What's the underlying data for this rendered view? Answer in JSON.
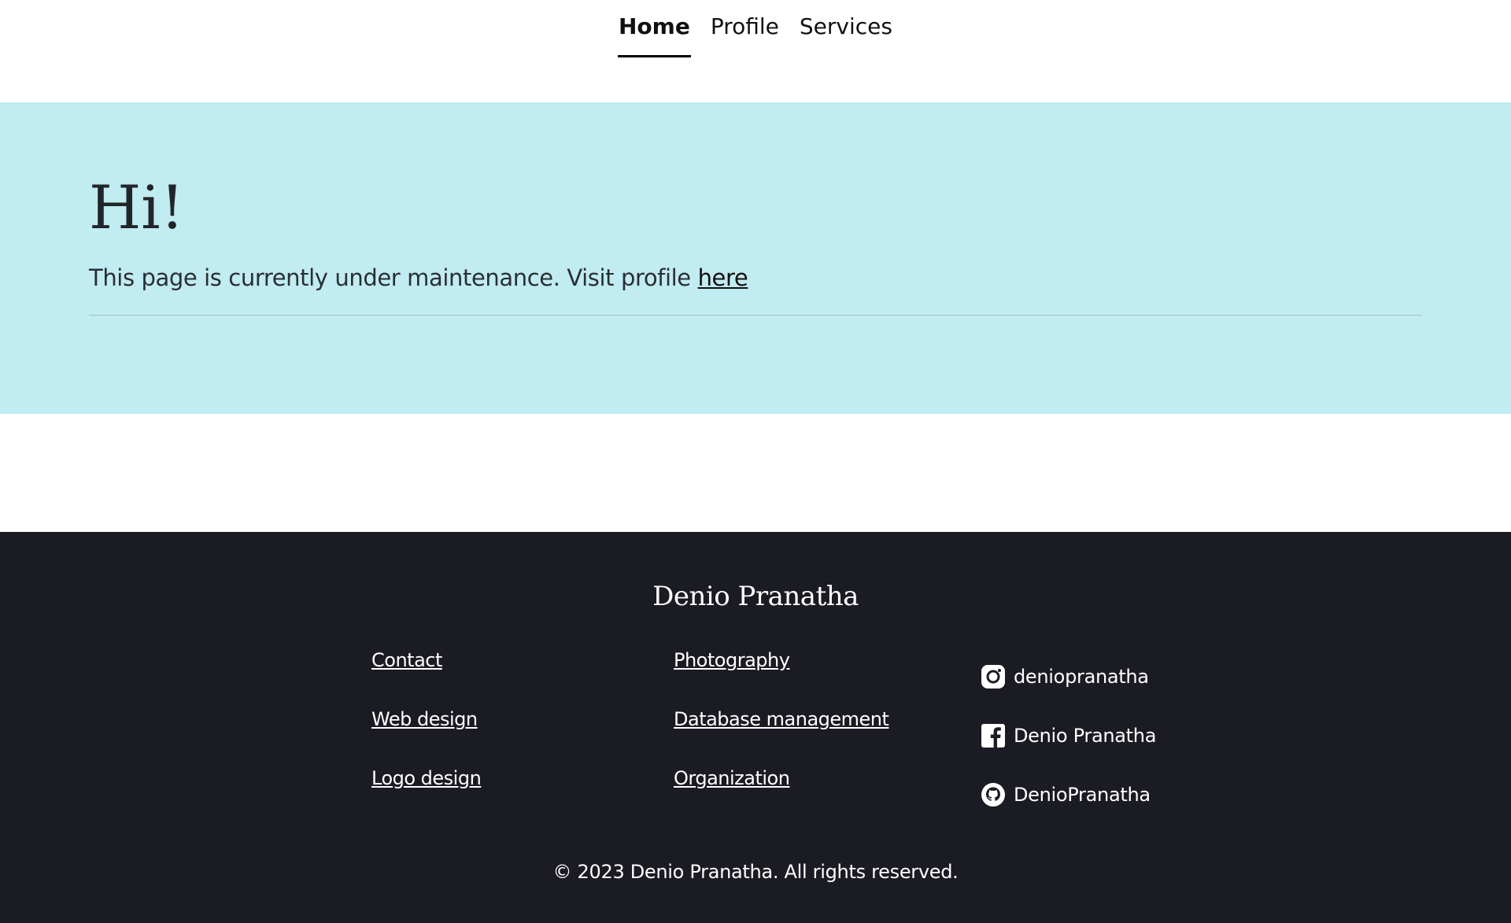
{
  "nav": {
    "items": [
      {
        "label": "Home"
      },
      {
        "label": "Profile"
      },
      {
        "label": "Services"
      }
    ]
  },
  "hero": {
    "title": "Hi!",
    "text": "This page is currently under maintenance. Visit profile ",
    "link_text": "here",
    "background_color": "#c1ecf1"
  },
  "footer": {
    "name": "Denio Pranatha",
    "links_col1": [
      {
        "label": "Contact"
      },
      {
        "label": "Web design"
      },
      {
        "label": "Logo design"
      }
    ],
    "links_col2": [
      {
        "label": "Photography"
      },
      {
        "label": "Database management"
      },
      {
        "label": "Organization"
      }
    ],
    "social": [
      {
        "icon": "instagram-icon",
        "label": "deniopranatha"
      },
      {
        "icon": "facebook-icon",
        "label": "Denio Pranatha"
      },
      {
        "icon": "github-icon",
        "label": "DenioPranatha"
      }
    ],
    "copyright": "© 2023 Denio Pranatha. All rights reserved.",
    "background_color": "#1b1b23"
  }
}
